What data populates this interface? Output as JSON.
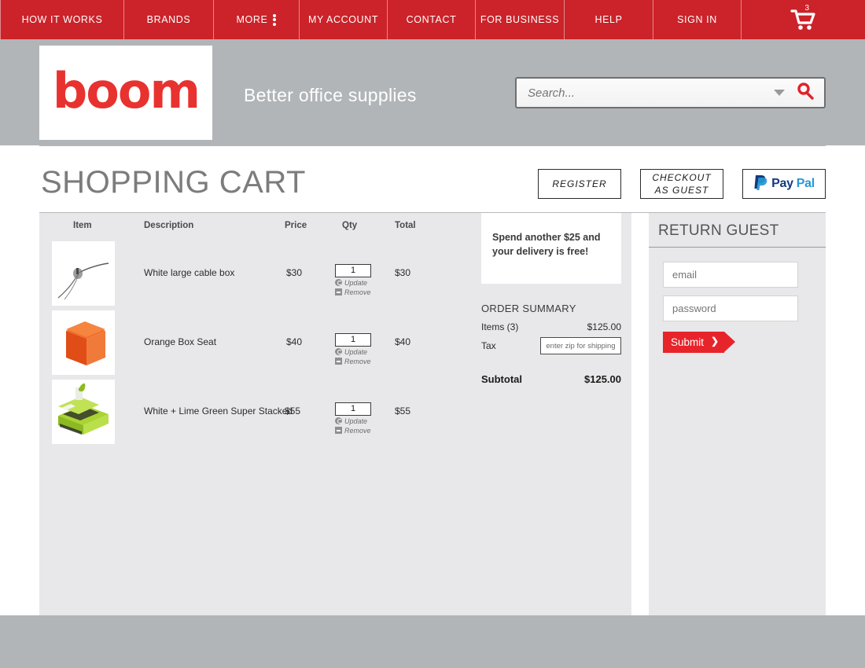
{
  "nav": {
    "items": [
      {
        "label": "HOW IT WORKS",
        "name": "nav-how-it-works"
      },
      {
        "label": "BRANDS",
        "name": "nav-brands"
      },
      {
        "label": "MORE",
        "name": "nav-more"
      },
      {
        "label": "MY ACCOUNT",
        "name": "nav-my-account"
      },
      {
        "label": "CONTACT",
        "name": "nav-contact"
      },
      {
        "label": "FOR BUSINESS",
        "name": "nav-for-business"
      },
      {
        "label": "HELP",
        "name": "nav-help"
      },
      {
        "label": "SIGN IN",
        "name": "nav-sign-in"
      }
    ],
    "more_icon": "vertical-dots-icon",
    "cart_icon": "shopping-cart-icon",
    "cart_count": "3",
    "bar_color": "#cc2229"
  },
  "header": {
    "logo_text": "boom",
    "logo_color": "#e8322f",
    "tagline": "Better office supplies",
    "band_color": "#b2b5b8"
  },
  "search": {
    "placeholder": "Search...",
    "value": "",
    "dropdown_icon": "chevron-down-icon",
    "search_icon": "magnifier-icon",
    "icon_color": "#e0232a"
  },
  "page": {
    "title": "SHOPPING CART"
  },
  "actions": {
    "register_label": "REGISTER",
    "guest_label_line1": "CHECKOUT",
    "guest_label_line2": "AS GUEST",
    "paypal_pay": "Pay",
    "paypal_pal": "Pal",
    "paypal_icon": "paypal-logo-icon"
  },
  "cart": {
    "headers": {
      "item": "Item",
      "description": "Description",
      "price": "Price",
      "qty": "Qty",
      "total": "Total"
    },
    "update_label": "Update",
    "remove_label": "Remove",
    "rows": [
      {
        "description": "White large cable box",
        "price": "$30",
        "qty": "1",
        "total": "$30",
        "thumb": "white-cable-box-thumbnail"
      },
      {
        "description": "Orange Box Seat",
        "price": "$40",
        "qty": "1",
        "total": "$40",
        "thumb": "orange-box-seat-thumbnail"
      },
      {
        "description": "White + Lime Green Super Stacked",
        "price": "$55",
        "qty": "1",
        "total": "$55",
        "thumb": "lime-green-stacked-thumbnail"
      }
    ]
  },
  "summary": {
    "promo_line1": "Spend another $25 and",
    "promo_line2": "your delivery is free!",
    "title": "ORDER SUMMARY",
    "items_label": "Items (3)",
    "items_value": "$125.00",
    "tax_label": "Tax",
    "zip_placeholder": "enter zip for shipping",
    "subtotal_label": "Subtotal",
    "subtotal_value": "$125.00"
  },
  "sidebar": {
    "title": "RETURN GUEST",
    "email_placeholder": "email",
    "email_value": "",
    "password_placeholder": "password",
    "password_value": "",
    "submit_label": "Submit",
    "submit_icon": "chevron-right-icon",
    "submit_color": "#e8242b"
  }
}
